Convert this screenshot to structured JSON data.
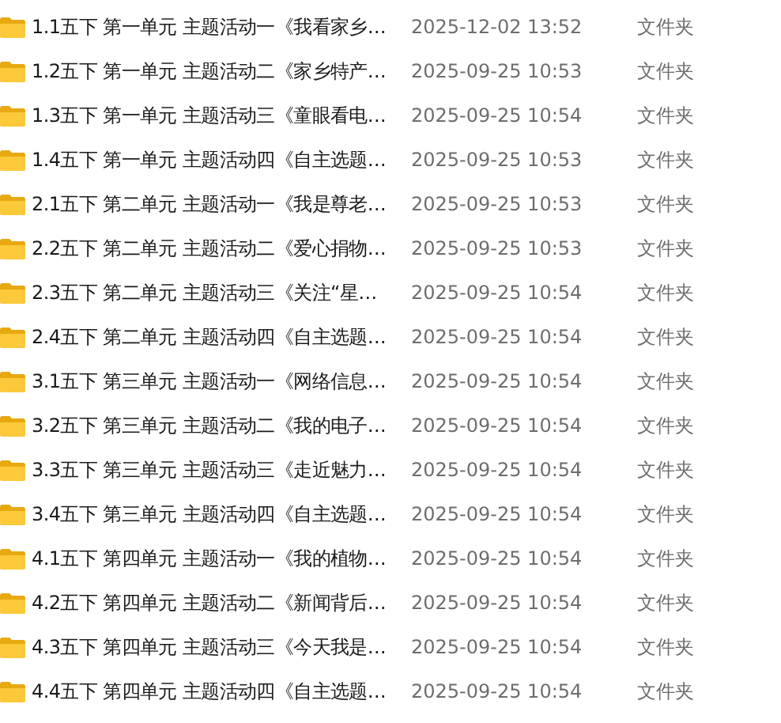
{
  "files": [
    {
      "name": "1.1五下 第一单元 主题活动一《我看家乡…",
      "modified": "2025-12-02 13:52",
      "type": "文件夹"
    },
    {
      "name": "1.2五下 第一单元 主题活动二《家乡特产…",
      "modified": "2025-09-25 10:53",
      "type": "文件夹"
    },
    {
      "name": "1.3五下 第一单元 主题活动三《童眼看电…",
      "modified": "2025-09-25 10:54",
      "type": "文件夹"
    },
    {
      "name": "1.4五下 第一单元 主题活动四《自主选题…",
      "modified": "2025-09-25 10:53",
      "type": "文件夹"
    },
    {
      "name": "2.1五下 第二单元 主题活动一《我是尊老…",
      "modified": "2025-09-25 10:53",
      "type": "文件夹"
    },
    {
      "name": "2.2五下 第二单元 主题活动二《爱心捐物…",
      "modified": "2025-09-25 10:53",
      "type": "文件夹"
    },
    {
      "name": "2.3五下 第二单元 主题活动三《关注“星…",
      "modified": "2025-09-25 10:54",
      "type": "文件夹"
    },
    {
      "name": "2.4五下 第二单元 主题活动四《自主选题…",
      "modified": "2025-09-25 10:54",
      "type": "文件夹"
    },
    {
      "name": "3.1五下 第三单元 主题活动一《网络信息…",
      "modified": "2025-09-25 10:54",
      "type": "文件夹"
    },
    {
      "name": "3.2五下 第三单元 主题活动二《我的电子…",
      "modified": "2025-09-25 10:54",
      "type": "文件夹"
    },
    {
      "name": "3.3五下 第三单元 主题活动三《走近魅力…",
      "modified": "2025-09-25 10:54",
      "type": "文件夹"
    },
    {
      "name": "3.4五下 第三单元 主题活动四《自主选题…",
      "modified": "2025-09-25 10:54",
      "type": "文件夹"
    },
    {
      "name": "4.1五下 第四单元 主题活动一《我的植物…",
      "modified": "2025-09-25 10:54",
      "type": "文件夹"
    },
    {
      "name": "4.2五下 第四单元 主题活动二《新闻背后…",
      "modified": "2025-09-25 10:54",
      "type": "文件夹"
    },
    {
      "name": "4.3五下 第四单元 主题活动三《今天我是…",
      "modified": "2025-09-25 10:54",
      "type": "文件夹"
    },
    {
      "name": "4.4五下 第四单元 主题活动四《自主选题…",
      "modified": "2025-09-25 10:54",
      "type": "文件夹"
    }
  ]
}
